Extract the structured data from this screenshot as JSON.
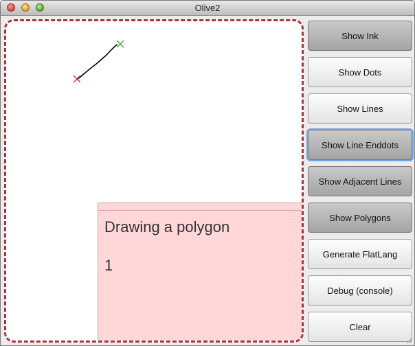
{
  "window": {
    "title": "Olive2"
  },
  "panel": {
    "heading": "Drawing a polygon",
    "count": "1"
  },
  "buttons": [
    {
      "label": "Show Ink",
      "active": true
    },
    {
      "label": "Show Dots",
      "active": false
    },
    {
      "label": "Show Lines",
      "active": false
    },
    {
      "label": "Show Line Enddots",
      "active": true,
      "focused": true
    },
    {
      "label": "Show Adjacent Lines",
      "active": true
    },
    {
      "label": "Show Polygons",
      "active": true
    },
    {
      "label": "Generate FlatLang",
      "active": false
    },
    {
      "label": "Debug (console)",
      "active": false
    },
    {
      "label": "Clear",
      "active": false
    }
  ],
  "colors": {
    "border": "#a8343a",
    "panel_bg": "#ffd7d9",
    "start_marker": "#c0393b",
    "end_marker": "#3aa63a",
    "ink": "#000000"
  }
}
